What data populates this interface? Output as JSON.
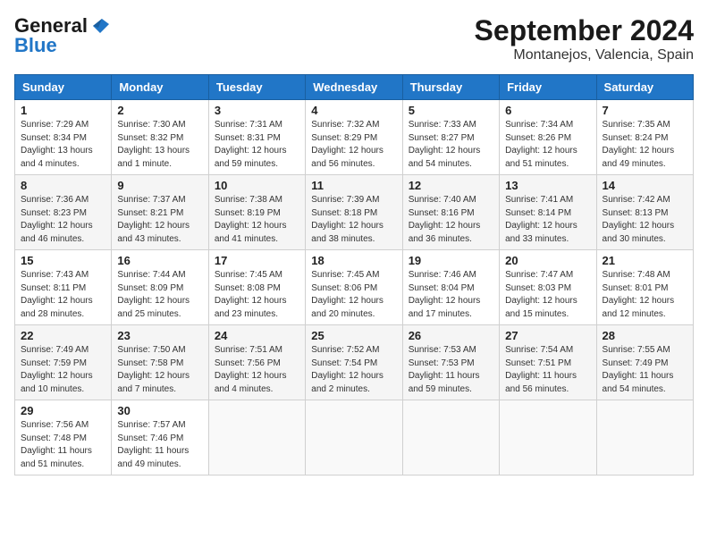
{
  "logo": {
    "line1": "General",
    "line2": "Blue"
  },
  "title": "September 2024",
  "subtitle": "Montanejos, Valencia, Spain",
  "headers": [
    "Sunday",
    "Monday",
    "Tuesday",
    "Wednesday",
    "Thursday",
    "Friday",
    "Saturday"
  ],
  "weeks": [
    [
      {
        "day": "1",
        "sunrise": "Sunrise: 7:29 AM",
        "sunset": "Sunset: 8:34 PM",
        "daylight": "Daylight: 13 hours and 4 minutes."
      },
      {
        "day": "2",
        "sunrise": "Sunrise: 7:30 AM",
        "sunset": "Sunset: 8:32 PM",
        "daylight": "Daylight: 13 hours and 1 minute."
      },
      {
        "day": "3",
        "sunrise": "Sunrise: 7:31 AM",
        "sunset": "Sunset: 8:31 PM",
        "daylight": "Daylight: 12 hours and 59 minutes."
      },
      {
        "day": "4",
        "sunrise": "Sunrise: 7:32 AM",
        "sunset": "Sunset: 8:29 PM",
        "daylight": "Daylight: 12 hours and 56 minutes."
      },
      {
        "day": "5",
        "sunrise": "Sunrise: 7:33 AM",
        "sunset": "Sunset: 8:27 PM",
        "daylight": "Daylight: 12 hours and 54 minutes."
      },
      {
        "day": "6",
        "sunrise": "Sunrise: 7:34 AM",
        "sunset": "Sunset: 8:26 PM",
        "daylight": "Daylight: 12 hours and 51 minutes."
      },
      {
        "day": "7",
        "sunrise": "Sunrise: 7:35 AM",
        "sunset": "Sunset: 8:24 PM",
        "daylight": "Daylight: 12 hours and 49 minutes."
      }
    ],
    [
      {
        "day": "8",
        "sunrise": "Sunrise: 7:36 AM",
        "sunset": "Sunset: 8:23 PM",
        "daylight": "Daylight: 12 hours and 46 minutes."
      },
      {
        "day": "9",
        "sunrise": "Sunrise: 7:37 AM",
        "sunset": "Sunset: 8:21 PM",
        "daylight": "Daylight: 12 hours and 43 minutes."
      },
      {
        "day": "10",
        "sunrise": "Sunrise: 7:38 AM",
        "sunset": "Sunset: 8:19 PM",
        "daylight": "Daylight: 12 hours and 41 minutes."
      },
      {
        "day": "11",
        "sunrise": "Sunrise: 7:39 AM",
        "sunset": "Sunset: 8:18 PM",
        "daylight": "Daylight: 12 hours and 38 minutes."
      },
      {
        "day": "12",
        "sunrise": "Sunrise: 7:40 AM",
        "sunset": "Sunset: 8:16 PM",
        "daylight": "Daylight: 12 hours and 36 minutes."
      },
      {
        "day": "13",
        "sunrise": "Sunrise: 7:41 AM",
        "sunset": "Sunset: 8:14 PM",
        "daylight": "Daylight: 12 hours and 33 minutes."
      },
      {
        "day": "14",
        "sunrise": "Sunrise: 7:42 AM",
        "sunset": "Sunset: 8:13 PM",
        "daylight": "Daylight: 12 hours and 30 minutes."
      }
    ],
    [
      {
        "day": "15",
        "sunrise": "Sunrise: 7:43 AM",
        "sunset": "Sunset: 8:11 PM",
        "daylight": "Daylight: 12 hours and 28 minutes."
      },
      {
        "day": "16",
        "sunrise": "Sunrise: 7:44 AM",
        "sunset": "Sunset: 8:09 PM",
        "daylight": "Daylight: 12 hours and 25 minutes."
      },
      {
        "day": "17",
        "sunrise": "Sunrise: 7:45 AM",
        "sunset": "Sunset: 8:08 PM",
        "daylight": "Daylight: 12 hours and 23 minutes."
      },
      {
        "day": "18",
        "sunrise": "Sunrise: 7:45 AM",
        "sunset": "Sunset: 8:06 PM",
        "daylight": "Daylight: 12 hours and 20 minutes."
      },
      {
        "day": "19",
        "sunrise": "Sunrise: 7:46 AM",
        "sunset": "Sunset: 8:04 PM",
        "daylight": "Daylight: 12 hours and 17 minutes."
      },
      {
        "day": "20",
        "sunrise": "Sunrise: 7:47 AM",
        "sunset": "Sunset: 8:03 PM",
        "daylight": "Daylight: 12 hours and 15 minutes."
      },
      {
        "day": "21",
        "sunrise": "Sunrise: 7:48 AM",
        "sunset": "Sunset: 8:01 PM",
        "daylight": "Daylight: 12 hours and 12 minutes."
      }
    ],
    [
      {
        "day": "22",
        "sunrise": "Sunrise: 7:49 AM",
        "sunset": "Sunset: 7:59 PM",
        "daylight": "Daylight: 12 hours and 10 minutes."
      },
      {
        "day": "23",
        "sunrise": "Sunrise: 7:50 AM",
        "sunset": "Sunset: 7:58 PM",
        "daylight": "Daylight: 12 hours and 7 minutes."
      },
      {
        "day": "24",
        "sunrise": "Sunrise: 7:51 AM",
        "sunset": "Sunset: 7:56 PM",
        "daylight": "Daylight: 12 hours and 4 minutes."
      },
      {
        "day": "25",
        "sunrise": "Sunrise: 7:52 AM",
        "sunset": "Sunset: 7:54 PM",
        "daylight": "Daylight: 12 hours and 2 minutes."
      },
      {
        "day": "26",
        "sunrise": "Sunrise: 7:53 AM",
        "sunset": "Sunset: 7:53 PM",
        "daylight": "Daylight: 11 hours and 59 minutes."
      },
      {
        "day": "27",
        "sunrise": "Sunrise: 7:54 AM",
        "sunset": "Sunset: 7:51 PM",
        "daylight": "Daylight: 11 hours and 56 minutes."
      },
      {
        "day": "28",
        "sunrise": "Sunrise: 7:55 AM",
        "sunset": "Sunset: 7:49 PM",
        "daylight": "Daylight: 11 hours and 54 minutes."
      }
    ],
    [
      {
        "day": "29",
        "sunrise": "Sunrise: 7:56 AM",
        "sunset": "Sunset: 7:48 PM",
        "daylight": "Daylight: 11 hours and 51 minutes."
      },
      {
        "day": "30",
        "sunrise": "Sunrise: 7:57 AM",
        "sunset": "Sunset: 7:46 PM",
        "daylight": "Daylight: 11 hours and 49 minutes."
      },
      null,
      null,
      null,
      null,
      null
    ]
  ]
}
